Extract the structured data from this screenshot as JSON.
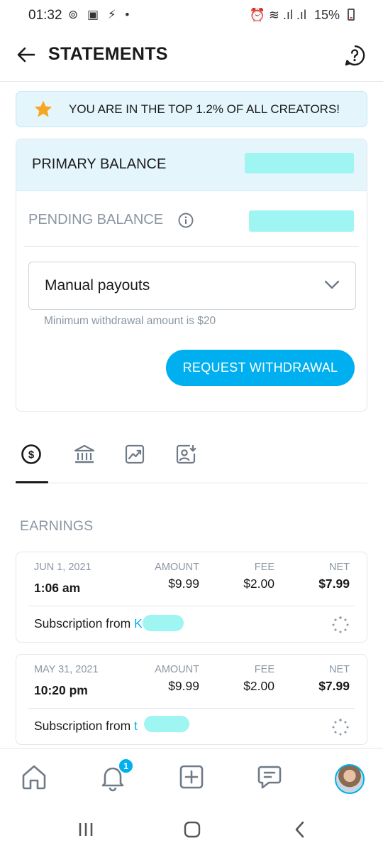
{
  "status_bar": {
    "time": "01:32",
    "left_icons": "⊚ ▣ ⚡ •",
    "battery_text": "15%",
    "signal_text": "⏰ ≋ .ıl .ıl"
  },
  "header": {
    "title": "STATEMENTS",
    "back_icon": "arrow-left-icon",
    "help_icon": "question-circle-icon"
  },
  "banner": {
    "text": "YOU ARE IN THE TOP 1.2% OF ALL CREATORS!",
    "icon": "star-icon",
    "star_color": "#f5a623"
  },
  "balance": {
    "primary_label": "PRIMARY BALANCE",
    "pending_label": "PENDING BALANCE",
    "payout_select_value": "Manual payouts",
    "min_note": "Minimum withdrawal amount is $20",
    "withdraw_button": "REQUEST WITHDRAWAL"
  },
  "tabs": [
    {
      "name": "earnings-tab",
      "icon": "dollar-circle-icon",
      "active": true
    },
    {
      "name": "bank-tab",
      "icon": "bank-icon",
      "active": false
    },
    {
      "name": "statistics-tab",
      "icon": "chart-icon",
      "active": false
    },
    {
      "name": "payout-requests-tab",
      "icon": "user-download-icon",
      "active": false
    }
  ],
  "section_title": "EARNINGS",
  "columns": {
    "amount": "AMOUNT",
    "fee": "FEE",
    "net": "NET"
  },
  "earnings": [
    {
      "date": "JUN 1, 2021",
      "time": "1:06 am",
      "amount": "$9.99",
      "fee": "$2.00",
      "net": "$7.99",
      "description": "Subscription from",
      "fan": "K"
    },
    {
      "date": "MAY 31, 2021",
      "time": "10:20 pm",
      "amount": "$9.99",
      "fee": "$2.00",
      "net": "$7.99",
      "description": "Subscription from",
      "fan": "t"
    }
  ],
  "bottom_nav": {
    "items": [
      "home-icon",
      "bell-icon",
      "plus-square-icon",
      "messages-icon",
      "avatar"
    ],
    "notification_count": "1"
  },
  "colors": {
    "accent": "#00aff0",
    "banner_bg": "#e4f5fc",
    "redaction": "#9ff5f2",
    "muted_text": "#8a96a3"
  }
}
